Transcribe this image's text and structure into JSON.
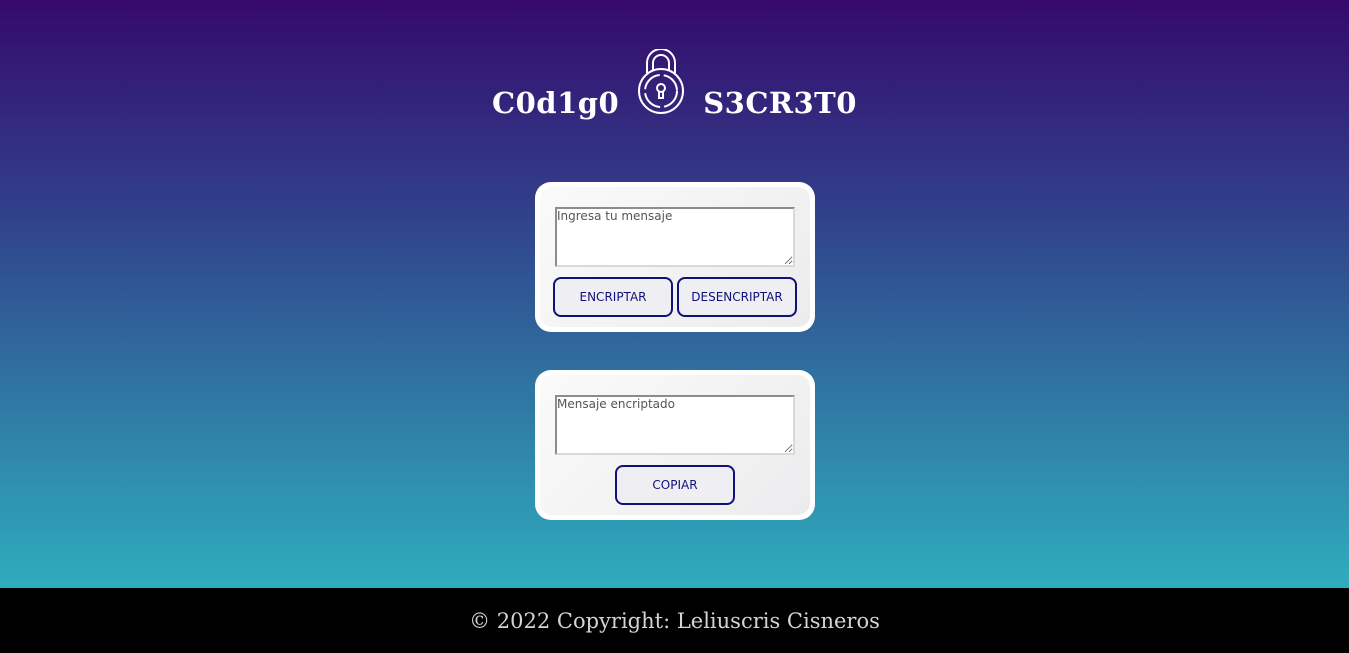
{
  "header": {
    "title_left": "C0d1g0",
    "title_right": "S3CR3T0",
    "icon": "lock-icon"
  },
  "encrypt_card": {
    "input_placeholder": "Ingresa tu mensaje",
    "input_value": "",
    "encrypt_label": "ENCRIPTAR",
    "decrypt_label": "DESENCRIPTAR"
  },
  "result_card": {
    "output_placeholder": "Mensaje encriptado",
    "output_value": "",
    "copy_label": "COPIAR"
  },
  "footer": {
    "text": "© 2022 Copyright: Leliuscris Cisneros"
  },
  "colors": {
    "gradient_top": "#350a6c",
    "gradient_bottom": "#2fadbe",
    "button_border": "#10127a",
    "footer_bg": "#000000"
  }
}
